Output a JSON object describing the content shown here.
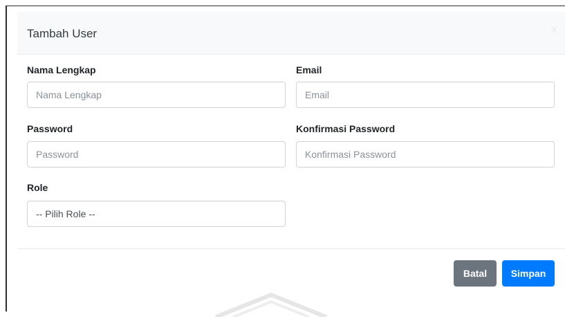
{
  "modal": {
    "title": "Tambah User",
    "close_glyph": "×"
  },
  "form": {
    "nama": {
      "label": "Nama Lengkap",
      "placeholder": "Nama Lengkap",
      "value": ""
    },
    "email": {
      "label": "Email",
      "placeholder": "Email",
      "value": ""
    },
    "password": {
      "label": "Password",
      "placeholder": "Password",
      "value": ""
    },
    "konfirmasi": {
      "label": "Konfirmasi Password",
      "placeholder": "Konfirmasi Password",
      "value": ""
    },
    "role": {
      "label": "Role",
      "selected": "-- Pilih Role --"
    }
  },
  "footer": {
    "cancel_label": "Batal",
    "save_label": "Simpan"
  },
  "colors": {
    "primary": "#007bff",
    "secondary": "#6c757d",
    "header_bg": "#f8f9fa"
  }
}
